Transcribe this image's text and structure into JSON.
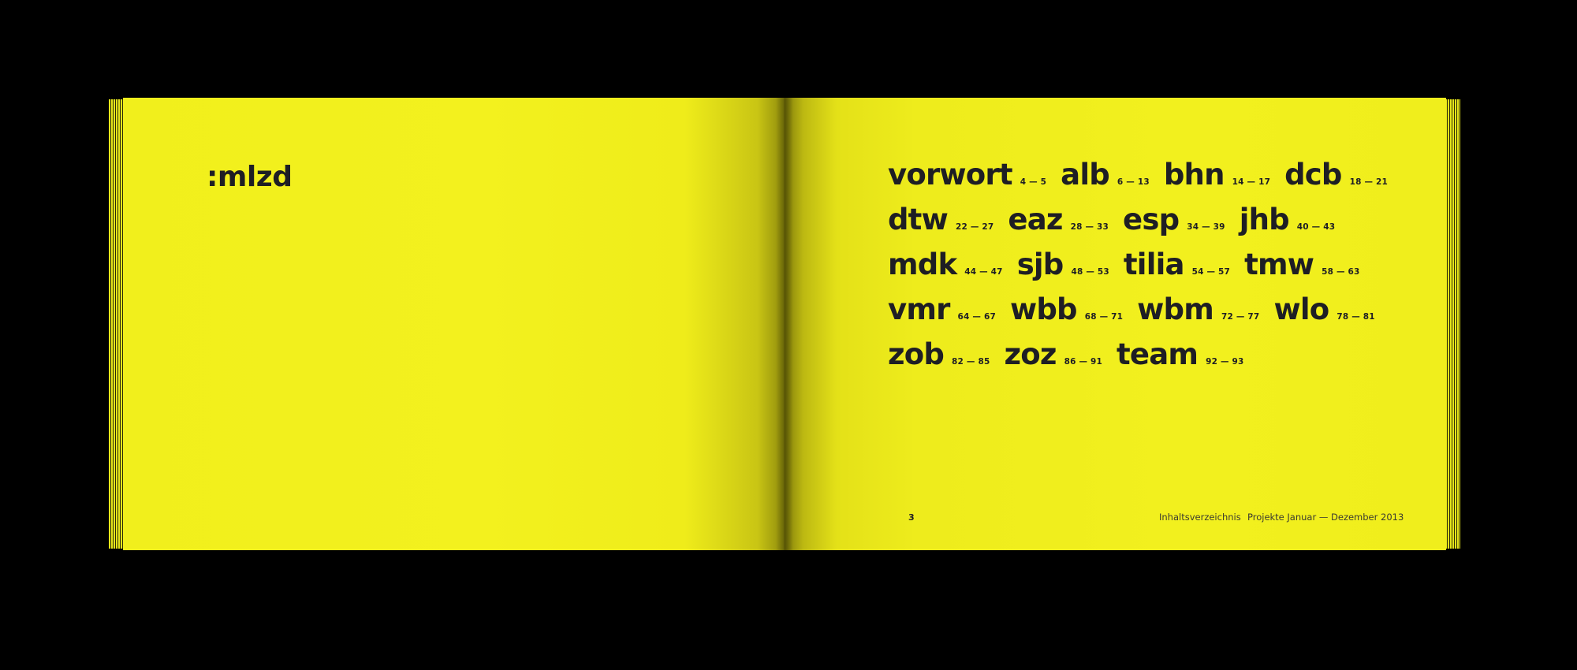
{
  "brand": ":mlzd",
  "toc": {
    "rows": [
      [
        {
          "name": "vorwort",
          "pages": "4 — 5"
        },
        {
          "name": "alb",
          "pages": "6 — 13"
        },
        {
          "name": "bhn",
          "pages": "14 — 17"
        },
        {
          "name": "dcb",
          "pages": "18 — 21"
        }
      ],
      [
        {
          "name": "dtw",
          "pages": "22 — 27"
        },
        {
          "name": "eaz",
          "pages": "28 — 33"
        },
        {
          "name": "esp",
          "pages": "34 — 39"
        },
        {
          "name": "jhb",
          "pages": "40 — 43"
        }
      ],
      [
        {
          "name": "mdk",
          "pages": "44 — 47"
        },
        {
          "name": "sjb",
          "pages": "48 — 53"
        },
        {
          "name": "tilia",
          "pages": "54 — 57"
        },
        {
          "name": "tmw",
          "pages": "58 — 63"
        }
      ],
      [
        {
          "name": "vmr",
          "pages": "64 — 67"
        },
        {
          "name": "wbb",
          "pages": "68 — 71"
        },
        {
          "name": "wbm",
          "pages": "72 — 77"
        },
        {
          "name": "wlo",
          "pages": "78 — 81"
        }
      ],
      [
        {
          "name": "zob",
          "pages": "82 — 85"
        },
        {
          "name": "zoz",
          "pages": "86 — 91"
        },
        {
          "name": "team",
          "pages": "92 — 93"
        }
      ]
    ]
  },
  "footer": {
    "page_number": "3",
    "section": "Inhaltsverzeichnis",
    "project_range": "Projekte Januar — Dezember 2013"
  },
  "colors": {
    "page_yellow": "#f2f01e",
    "ink": "#1e1e24",
    "background": "#000000"
  }
}
